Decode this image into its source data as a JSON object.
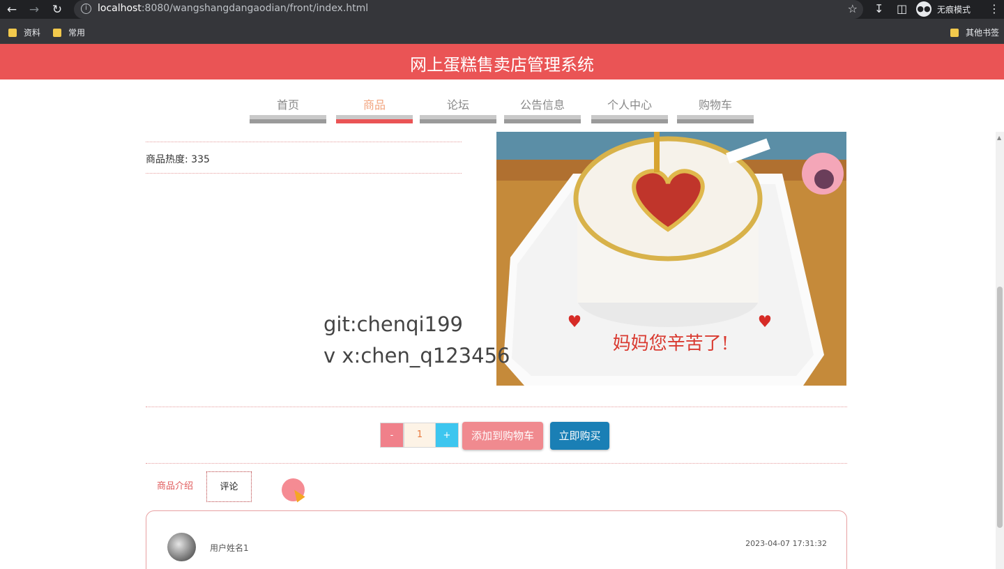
{
  "browser": {
    "url_host": "localhost",
    "url_rest": ":8080/wangshangdangaodian/front/index.html",
    "incognito_label": "无痕模式",
    "bookmarks": [
      "资料",
      "常用"
    ],
    "other_bookmarks": "其他书签"
  },
  "site": {
    "title": "网上蛋糕售卖店管理系统"
  },
  "nav": {
    "items": [
      "首页",
      "商品",
      "论坛",
      "公告信息",
      "个人中心",
      "购物车"
    ],
    "active_index": 1
  },
  "product": {
    "cut_text": "...",
    "hot_label": "商品热度: 335",
    "image_caption": "妈妈您辛苦了!",
    "quantity": "1",
    "minus_label": "-",
    "plus_label": "+",
    "add_to_cart_label": "添加到购物车",
    "buy_now_label": "立即购买"
  },
  "watermark": {
    "line1": "git:chenqi199",
    "line2": "v x:chen_q123456"
  },
  "tabs": {
    "intro_label": "商品介绍",
    "review_label": "评论"
  },
  "review": {
    "username": "用户姓名1",
    "time": "2023-04-07 17:31:32"
  },
  "colors": {
    "header_red": "#ea5455",
    "minus_btn": "#f0808a",
    "plus_btn": "#3dc6ef",
    "cart_btn": "#f08a8f",
    "buy_btn": "#1a7fb5"
  }
}
